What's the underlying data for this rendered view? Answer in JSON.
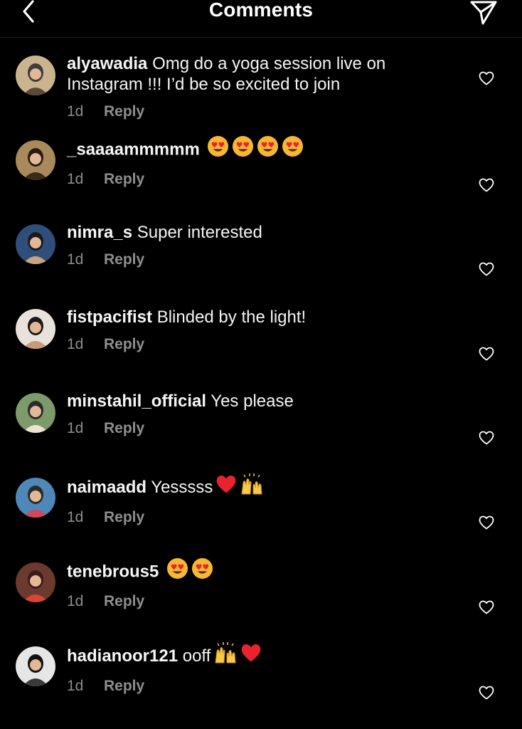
{
  "header": {
    "title": "Comments",
    "back_icon": "chevron-left-icon",
    "share_icon": "paper-plane-icon"
  },
  "colors": {
    "background": "#000000",
    "text": "#f5f5f5",
    "secondary": "#8e8e8e"
  },
  "comments": [
    {
      "username": "alyawadia",
      "text": "Omg do a yoga session live on Instagram !!! I’d be so excited to join",
      "emojis": [],
      "time": "1d",
      "reply": "Reply"
    },
    {
      "username": "_saaaammmmm",
      "text": "",
      "emojis": [
        "heart-eyes-emoji",
        "heart-eyes-emoji",
        "heart-eyes-emoji",
        "heart-eyes-emoji"
      ],
      "time": "1d",
      "reply": "Reply"
    },
    {
      "username": "nimra_s",
      "text": "Super interested",
      "emojis": [],
      "time": "1d",
      "reply": "Reply"
    },
    {
      "username": "fistpacifist",
      "text": "Blinded by the light!",
      "emojis": [],
      "time": "1d",
      "reply": "Reply"
    },
    {
      "username": "minstahil_official",
      "text": "Yes please",
      "emojis": [],
      "time": "1d",
      "reply": "Reply"
    },
    {
      "username": "naimaadd",
      "text": "Yesssss",
      "emojis": [
        "red-heart-emoji",
        "raising-hands-emoji"
      ],
      "time": "1d",
      "reply": "Reply"
    },
    {
      "username": "tenebrous5",
      "text": "",
      "emojis": [
        "heart-eyes-emoji",
        "heart-eyes-emoji"
      ],
      "time": "1d",
      "reply": "Reply"
    },
    {
      "username": "hadianoor121",
      "text": "ooff",
      "emojis": [
        "raising-hands-emoji",
        "red-heart-emoji"
      ],
      "time": "1d",
      "reply": "Reply"
    }
  ]
}
